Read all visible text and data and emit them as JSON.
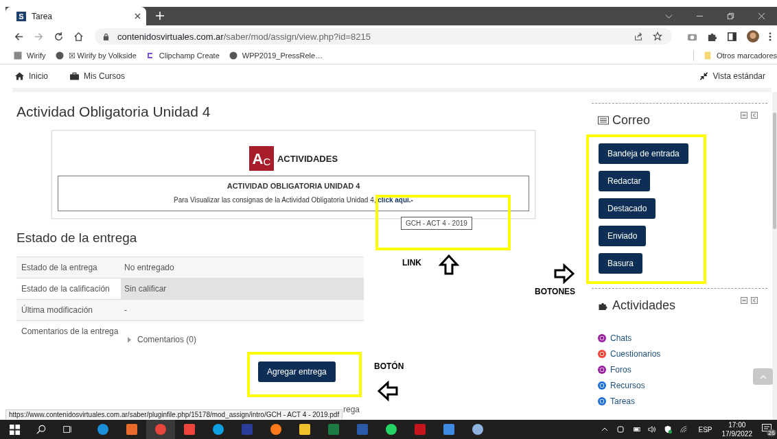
{
  "browser": {
    "tab": {
      "title": "Tarea",
      "favicon": "S"
    },
    "url": {
      "host": "contenidosvirtuales.com.ar",
      "path": "/saber/mod/assign/view.php?id=8215"
    },
    "bookmarks": [
      {
        "label": "Wirify",
        "kind": "image"
      },
      {
        "label": "☒ Wirify by Volkside",
        "kind": "globe"
      },
      {
        "label": "Clipchamp Create",
        "kind": "clipchamp"
      },
      {
        "label": "WPP2019_PressRele…",
        "kind": "globe"
      }
    ],
    "other_bookmarks": "Otros marcadores",
    "status_url": "https://www.contenidosvirtuales.com.ar/saber/pluginfile.php/15178/mod_assign/intro/GCH - ACT 4 - 2019.pdf"
  },
  "navbar": {
    "items": [
      {
        "label": "Inicio",
        "kind": "home"
      },
      {
        "label": "Mis Cursos",
        "kind": "briefcase"
      }
    ],
    "view_toggle": "Vista estándar"
  },
  "page": {
    "title": "Actividad Obligatoria Unidad 4",
    "intro": {
      "logo": [
        "A",
        "C"
      ],
      "logo_caption": "ACTIVIDADES",
      "heading": "ACTIVIDAD OBLIGATORIA UNIDAD 4",
      "text": "Para Visualizar las consignas de la Actividad Obligatoria Unidad 4,",
      "link": "click aquí.-",
      "tooltip": "GCH - ACT 4 - 2019"
    },
    "status": {
      "title": "Estado de la entrega",
      "rows": [
        {
          "label": "Estado de la entrega",
          "value": "No entregado",
          "kind": "text",
          "hovered": false
        },
        {
          "label": "Estado de la calificación",
          "value": "Sin calificar",
          "kind": "text",
          "hovered": true
        },
        {
          "label": "Última modificación",
          "value": "-",
          "kind": "text",
          "hovered": false
        },
        {
          "label": "Comentarios de la entrega",
          "value": "Comentarios (0)",
          "kind": "comments",
          "hovered": false
        }
      ]
    },
    "submit_button": "Agregar entrega",
    "cut_text": "rega"
  },
  "sidebar": {
    "mail": {
      "title": "Correo",
      "buttons": [
        "Bandeja de entrada",
        "Redactar",
        "Destacado",
        "Enviado",
        "Basura"
      ]
    },
    "activities": {
      "title": "Actividades",
      "items": [
        {
          "label": "Chats",
          "color": "#9c1fa3"
        },
        {
          "label": "Cuestionarios",
          "color": "#f44336"
        },
        {
          "label": "Foros",
          "color": "#9c1fa3"
        },
        {
          "label": "Recursos",
          "color": "#1e6fd9"
        },
        {
          "label": "Tareas",
          "color": "#1e6fd9"
        }
      ]
    }
  },
  "annotations": [
    {
      "label": "LINK",
      "kind": "up"
    },
    {
      "label": "BOTONES",
      "kind": "right"
    },
    {
      "label": "BOTÓN",
      "kind": "left"
    }
  ],
  "taskbar": {
    "apps": [
      {
        "kind": "edge",
        "active": false
      },
      {
        "kind": "player",
        "active": false
      },
      {
        "kind": "chrome",
        "active": true
      },
      {
        "kind": "anydesk",
        "active": false
      },
      {
        "kind": "skype",
        "active": false
      },
      {
        "kind": "save",
        "active": false
      },
      {
        "kind": "firefox",
        "active": false
      },
      {
        "kind": "folder",
        "active": false
      },
      {
        "kind": "excel",
        "active": false
      },
      {
        "kind": "word",
        "active": false
      },
      {
        "kind": "whatsapp",
        "active": false
      },
      {
        "kind": "pdf",
        "active": false
      },
      {
        "kind": "photos",
        "active": false
      },
      {
        "kind": "paint",
        "active": false
      }
    ],
    "tray": {
      "language": "ESP",
      "time": "17:00",
      "date": "17/9/2022",
      "notifications": "26"
    }
  }
}
